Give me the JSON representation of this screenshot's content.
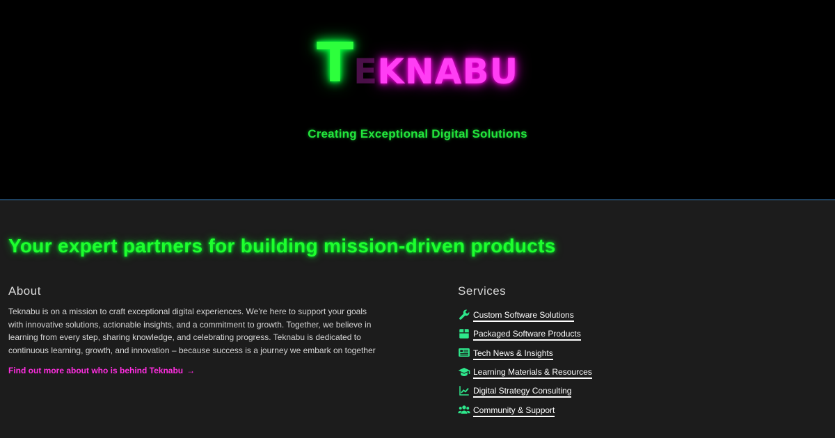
{
  "hero": {
    "logo_first": "T",
    "logo_second": "E",
    "logo_rest": "KNABU",
    "tagline": "Creating Exceptional Digital Solutions"
  },
  "headline": "Your expert partners for building mission-driven products",
  "about": {
    "title": "About",
    "text": "Teknabu is on a mission to craft exceptional digital experiences. We're here to support your goals with innovative solutions, actionable insights, and a commitment to growth. Together, we believe in learning from every step, sharing knowledge, and celebrating progress. Teknabu is dedicated to continuous learning, growth, and innovation – because success is a journey we embark on together",
    "link_label": "Find out more about who is behind Teknabu",
    "link_arrow": "→"
  },
  "services": {
    "title": "Services",
    "items": [
      {
        "label": "Custom Software Solutions",
        "icon": "wrench-icon"
      },
      {
        "label": "Packaged Software Products",
        "icon": "package-icon"
      },
      {
        "label": "Tech News & Insights",
        "icon": "newspaper-icon"
      },
      {
        "label": "Learning Materials & Resources",
        "icon": "graduation-cap-icon"
      },
      {
        "label": "Digital Strategy Consulting",
        "icon": "chart-line-icon"
      },
      {
        "label": "Community & Support",
        "icon": "users-icon"
      }
    ]
  },
  "colors": {
    "neon_green": "#1eff2e",
    "neon_magenta": "#ff3ef4",
    "icon_green": "#2ee88c",
    "background": "#1c1c1c",
    "hero_background": "#000000",
    "divider": "#3d8fd6"
  }
}
